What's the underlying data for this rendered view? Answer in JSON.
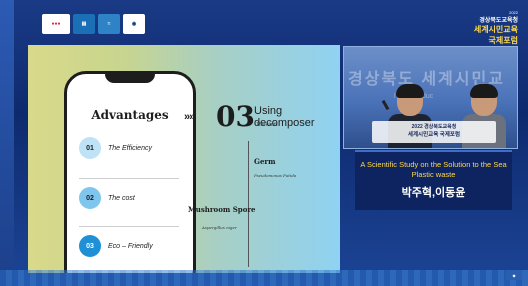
{
  "event": {
    "year": "2022",
    "title_line1": "경상북도교육청",
    "title_line2": "세계시민교육",
    "title_line3": "국제포럼"
  },
  "logos": [
    "sdg-logo",
    "goal-4-logo",
    "goal-14-logo",
    "unesco-logo"
  ],
  "slide": {
    "advantages_title": "Advantages",
    "items": [
      {
        "num": "01",
        "label": "The Efficiency",
        "circle_color": "#bfe3f6"
      },
      {
        "num": "02",
        "label": "The cost",
        "circle_color": "#7fc6ee"
      },
      {
        "num": "03",
        "label": "Eco – Friendly",
        "circle_color": "#1f8fd6"
      }
    ],
    "arrows": "»»",
    "section_num": "03",
    "heading": "Using decomposer",
    "subheading": "The kinds",
    "germ_label": "Germ",
    "germ_species": "Pseudomonas Putida",
    "mushroom_label": "Mushroom Spore",
    "mushroom_species": "Aspergillus niger"
  },
  "camera": {
    "bg_text": "경상북도 세계시민교",
    "bg_text2": "l Citi ... Educ",
    "banner_line1": "2022 경상북도교육청",
    "banner_line2": "세계시민교육 국제포럼"
  },
  "caption": {
    "title": "A Scientific Study on the Solution to the Sea Plastic waste",
    "names": "박주혁,이동윤"
  },
  "colors": {
    "background": "#0e2a6e",
    "caption_text": "#ffd84a",
    "slide_gradient_left": "#d9d98a",
    "slide_gradient_right": "#8fd2f2"
  }
}
